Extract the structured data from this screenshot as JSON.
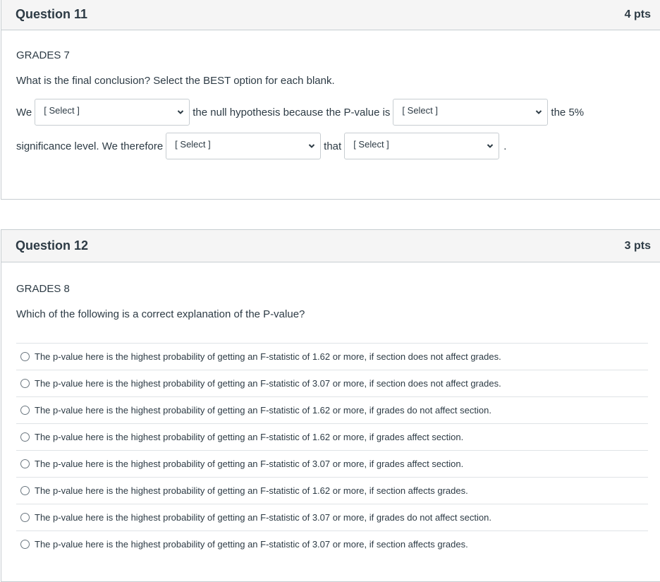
{
  "questions": [
    {
      "title": "Question 11",
      "points": "4 pts",
      "label": "GRADES 7",
      "prompt": "What is the final conclusion?  Select the BEST option for each blank.",
      "sentence": {
        "part1": "We",
        "select1": "[ Select ]",
        "part2": "the null hypothesis because the P-value is",
        "select2": "[ Select ]",
        "part3": "the 5%",
        "part4": "significance level.  We therefore",
        "select3": "[ Select ]",
        "part5": "that",
        "select4": "[ Select ]",
        "part6": "."
      }
    },
    {
      "title": "Question 12",
      "points": "3 pts",
      "label": "GRADES 8",
      "prompt": "Which of the following is a correct explanation of the P-value?",
      "answers": [
        "The p-value here is the highest probability of getting an F-statistic of 1.62 or more, if section does not affect grades.",
        "The p-value here is the highest probability of getting an F-statistic of 3.07 or more, if section does not affect grades.",
        "The p-value here is the highest probability of getting an F-statistic of 1.62 or more, if grades do not affect section.",
        "The p-value here is the highest probability of getting an F-statistic of 1.62 or more, if grades affect section.",
        "The p-value here is the highest probability of getting an F-statistic of 3.07 or more, if grades affect section.",
        "The p-value here is the highest probability of getting an F-statistic of 1.62 or more, if section affects grades.",
        "The p-value here is the highest probability of getting an F-statistic of 3.07 or more, if grades do not affect section.",
        "The p-value here is the highest probability of getting an F-statistic of 3.07 or more, if section affects grades."
      ]
    }
  ]
}
